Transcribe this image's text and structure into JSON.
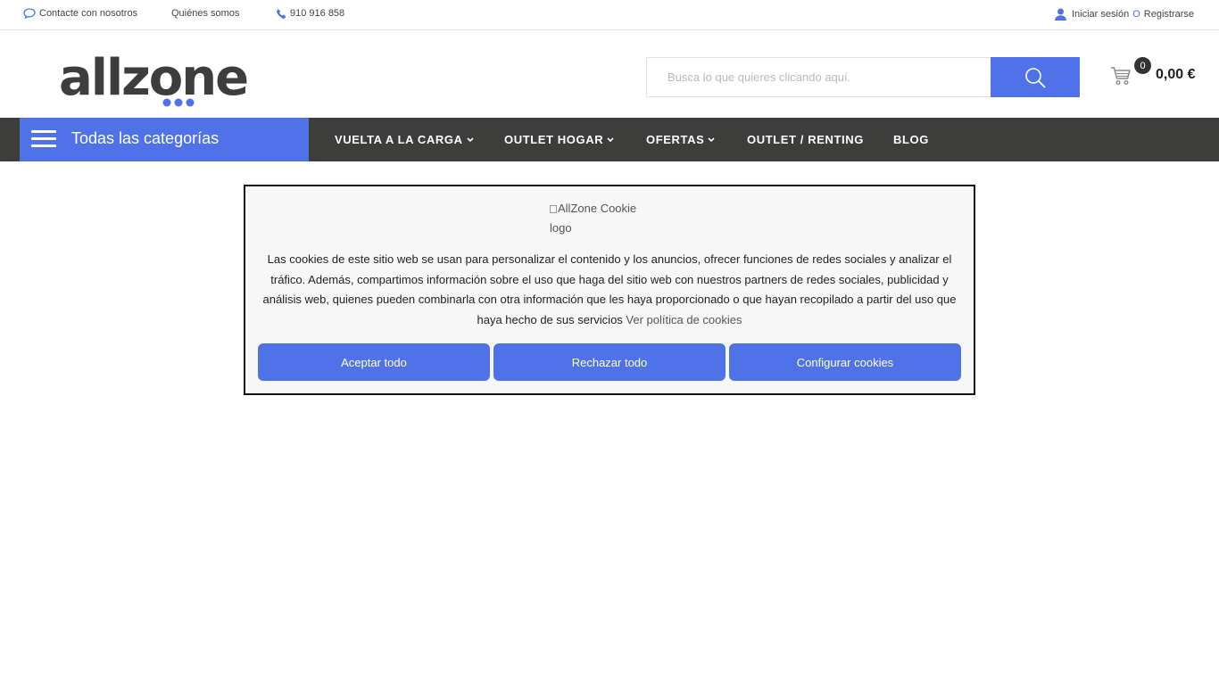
{
  "topbar": {
    "contact_label": "Contacte con nosotros",
    "about_label": "Quiénes somos",
    "phone_label": "910 916 858",
    "login_label": "Iniciar sesión",
    "separator": "O",
    "register_label": "Registrarse"
  },
  "header": {
    "logo_text": "allzone",
    "search_placeholder": "Busca lo que quieres clicando aquí.",
    "cart_count": "0",
    "cart_total": "0,00 €"
  },
  "nav": {
    "categories_label": "Todas las categorías",
    "items": [
      {
        "label": "VUELTA A LA CARGA",
        "has_dropdown": true
      },
      {
        "label": "OUTLET HOGAR",
        "has_dropdown": true
      },
      {
        "label": "OFERTAS",
        "has_dropdown": true
      },
      {
        "label": "OUTLET / RENTING",
        "has_dropdown": false
      },
      {
        "label": "BLOG",
        "has_dropdown": false
      }
    ]
  },
  "cookie": {
    "logo_alt": "AllZone Cookie logo",
    "text": "Las cookies de este sitio web se usan para personalizar el contenido y los anuncios, ofrecer funciones de redes sociales y analizar el tráfico. Además, compartimos información sobre el uso que haga del sitio web con nuestros partners de redes sociales, publicidad y análisis web, quienes pueden combinarla con otra información que les haya proporcionado o que hayan recopilado a partir del uso que haya hecho de sus servicios",
    "policy_link": "Ver política de cookies",
    "accept_label": "Aceptar todo",
    "reject_label": "Rechazar todo",
    "configure_label": "Configurar cookies"
  },
  "colors": {
    "accent": "#5072e9",
    "nav_bg": "#3d3d3c",
    "dark_text": "#333333",
    "cookie_bg": "#f7f7f7"
  },
  "icons": {
    "contact": "chat-bubble-icon",
    "phone": "phone-icon",
    "user": "user-icon",
    "search": "search-icon",
    "cart": "cart-icon",
    "menu": "hamburger-icon",
    "dropdown": "chevron-down-icon"
  }
}
